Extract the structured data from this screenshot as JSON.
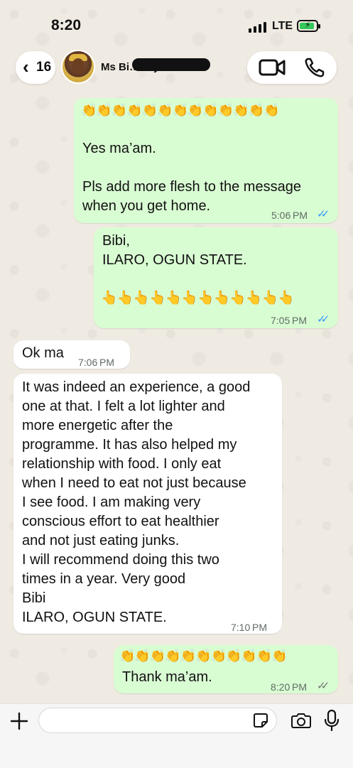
{
  "status_bar": {
    "time": "8:20",
    "network": "LTE"
  },
  "header": {
    "back_count": "16",
    "contact_name": "Ms Bi… …yemi...",
    "icons": [
      "chevron-left-icon",
      "video-call-icon",
      "phone-call-icon"
    ]
  },
  "messages": [
    {
      "direction": "outgoing",
      "emojis": "👏👏👏👏👏👏👏👏👏👏👏👏👏",
      "text": "Yes ma’am.\n\nPls add more flesh to the message\nwhen you get home.",
      "time": "5:06 PM",
      "status": "read"
    },
    {
      "direction": "outgoing",
      "text": "Bibi,\nILARO, OGUN STATE.",
      "emojis": "👆👆👆👆👆👆👆👆👆👆👆👆",
      "time": "7:05 PM",
      "status": "read"
    },
    {
      "direction": "incoming",
      "text": "Ok ma",
      "time": "7:06 PM"
    },
    {
      "direction": "incoming",
      "text": "It was indeed an experience, a good\none at that. I felt a lot lighter and\nmore energetic after the\nprogramme. It has also helped my\nrelationship with food. I only eat\nwhen I need to eat not just because\nI see food. I am making very\nconscious effort to eat healthier\nand not just eating junks.\nI will recommend doing this two\ntimes in a year. Very good\nBibi\nILARO, OGUN STATE.",
      "time": "7:10 PM"
    },
    {
      "direction": "outgoing",
      "emojis": "👏👏👏👏👏👏👏👏👏👏👏",
      "text": "Thank ma’am.",
      "time": "8:20 PM",
      "status": "delivered"
    }
  ],
  "ticks_glyph": "✓✓",
  "composer": {
    "placeholder": ""
  },
  "colors": {
    "outgoing_bubble": "#d9fdd3",
    "incoming_bubble": "#ffffff",
    "read_ticks": "#3497f9",
    "wallpaper": "#efeae2"
  }
}
